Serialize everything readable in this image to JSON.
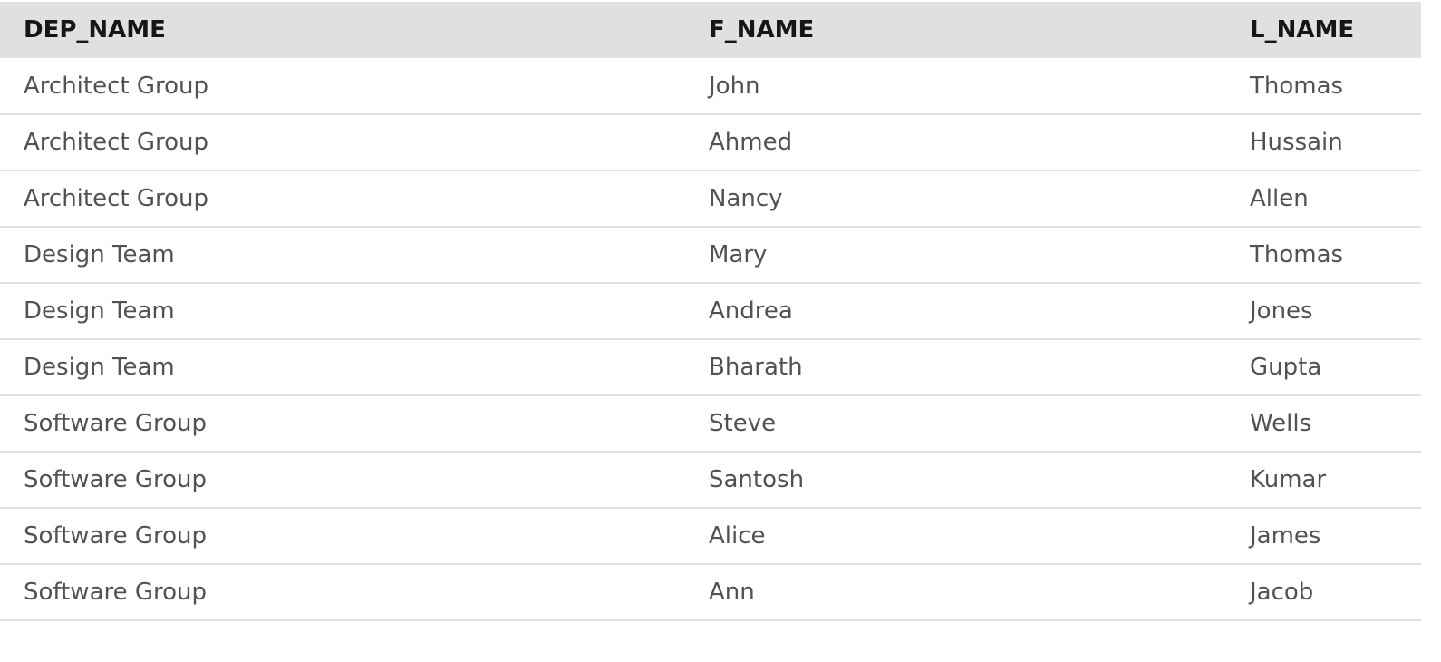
{
  "table": {
    "columns": [
      "DEP_NAME",
      "F_NAME",
      "L_NAME"
    ],
    "rows": [
      [
        "Architect Group",
        "John",
        "Thomas"
      ],
      [
        "Architect Group",
        "Ahmed",
        "Hussain"
      ],
      [
        "Architect Group",
        "Nancy",
        "Allen"
      ],
      [
        "Design Team",
        "Mary",
        "Thomas"
      ],
      [
        "Design Team",
        "Andrea",
        "Jones"
      ],
      [
        "Design Team",
        "Bharath",
        "Gupta"
      ],
      [
        "Software Group",
        "Steve",
        "Wells"
      ],
      [
        "Software Group",
        "Santosh",
        "Kumar"
      ],
      [
        "Software Group",
        "Alice",
        "James"
      ],
      [
        "Software Group",
        "Ann",
        "Jacob"
      ]
    ]
  },
  "colors": {
    "header_bg": "#e0e0e0",
    "header_text": "#161616",
    "cell_text": "#525252",
    "row_divider": "#e0e0e0"
  }
}
